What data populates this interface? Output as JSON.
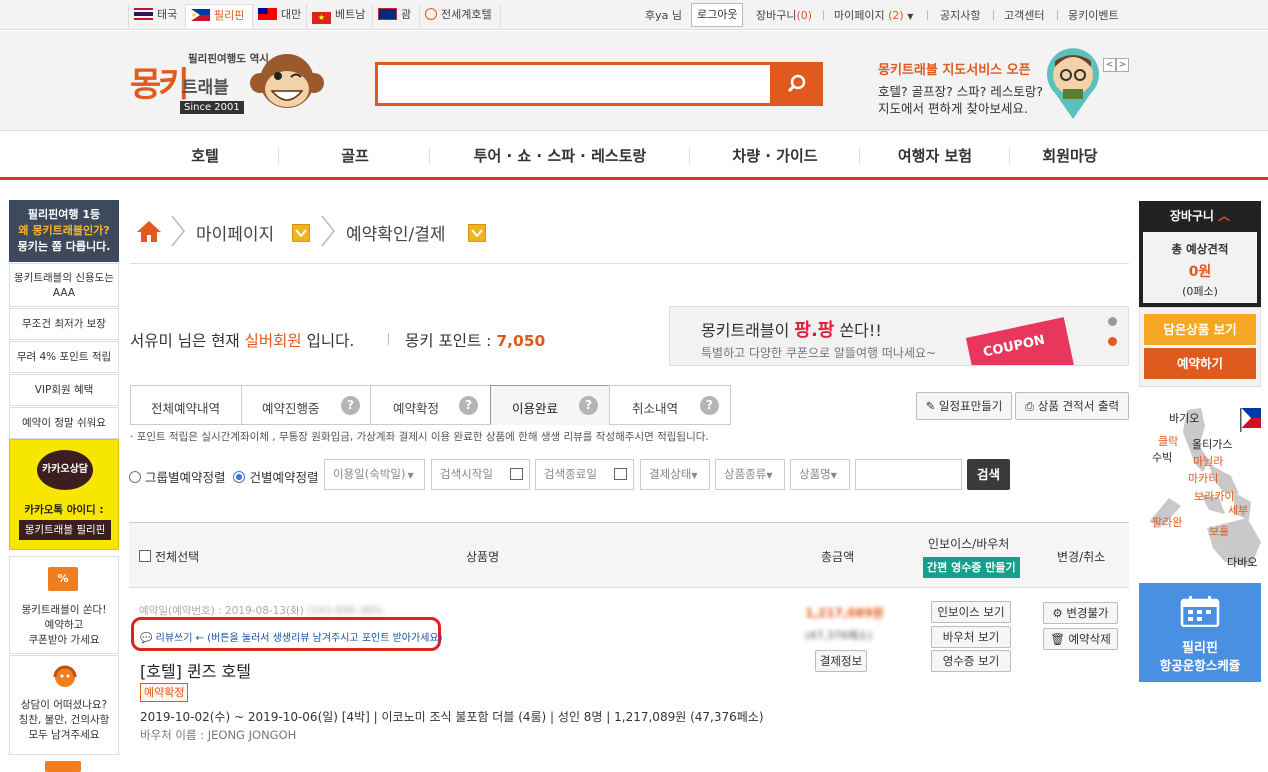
{
  "topbar": {
    "langs": [
      "태국",
      "필리핀",
      "대만",
      "베트남",
      "괌",
      "전세계호텔"
    ],
    "user": "후ya 님",
    "logout": "로그아웃",
    "cart": "장바구니",
    "cart_count": "(0)",
    "mypage": "마이페이지",
    "mypage_count": "(2)",
    "notice": "공지사항",
    "support": "고객센터",
    "event": "몽키이벤트"
  },
  "header": {
    "logo_tagline": "필리핀여행도 역시",
    "logo_main": "몽키",
    "logo_sub": "트래블",
    "logo_since": "Since 2001",
    "map_title": "몽키트래블 지도서비스 오픈",
    "map_line1": "호텔? 골프장? 스파? 레스토랑?",
    "map_line2": "지도에서 편하게 찾아보세요."
  },
  "nav": [
    "호텔",
    "골프",
    "투어 · 쇼 · 스파 · 레스토랑",
    "차량 · 가이드",
    "여행자 보험",
    "회원마당"
  ],
  "left_sidebar": {
    "promo_line1": "필리핀여행 1등",
    "promo_line2": "왜 몽키트래블인가?",
    "promo_line3": "몽키는 쫌 다릅니다.",
    "items": [
      "몽키트래블의 신용도는 AAA",
      "무조건 최저가 보장",
      "무려 4% 포인트 적립",
      "VIP회원 혜택",
      "예약이 정말 쉬워요"
    ],
    "kakao_bubble": "카카오상담",
    "kakao_label": "카카오톡 아이디 :",
    "kakao_id": "몽키트래블 필리핀",
    "coupon_line1": "몽키트래블이 쏜다!",
    "coupon_line2": "예약하고",
    "coupon_line3": "쿠폰받아 가세요",
    "survey_line1": "상담이 어떠셨나요?",
    "survey_line2": "칭찬, 불만, 건의사항",
    "survey_line3": "모두 남겨주세요"
  },
  "breadcrumb": {
    "level1": "마이페이지",
    "level2": "예약확인/결제"
  },
  "member": {
    "name_prefix": "서유미 님은 현재 ",
    "grade": "실버회원",
    "name_suffix": " 입니다.",
    "points_label": "몽키 포인트 : ",
    "points": "7,050"
  },
  "banner": {
    "title_prefix": "몽키트래블이 ",
    "title_hl": "팡.팡",
    "title_suffix": " 쏜다!!",
    "sub": "특별하고 다양한 쿠폰으로 알뜰여행 떠나세요~",
    "coupon": "COUPON"
  },
  "tabs": [
    "전체예약내역",
    "예약진행중",
    "예약확정",
    "이용완료",
    "취소내역"
  ],
  "tab_help": "?",
  "actions": {
    "schedule": "일정표만들기",
    "estimate": "상품 견적서 출력"
  },
  "notice": "포인트 적립은 실시간계좌이체 , 무통장 원화입금, 가상계좌 결제시 이용 완료한 상품에 한해 생생 리뷰를 작성해주시면 적립됩니다.",
  "filters": {
    "group_label": "그룹별예약정렬",
    "each_label": "건별예약정렬",
    "use_date": "이용일(숙박일)",
    "search_start": "검색시작일",
    "search_end": "검색종료일",
    "pay_status": "결제상태",
    "product_type": "상품종류",
    "product_name": "상품명",
    "keyword": "",
    "search_button": "검색"
  },
  "table": {
    "select_all": "전체선택",
    "col_product": "상품명",
    "col_total": "총금액",
    "col_invoice": "인보이스/바우처",
    "receipt_button": "간편 영수증 만들기",
    "col_change": "변경/취소"
  },
  "booking": {
    "meta": "예약일(예약번호) : 2019-08-13(화)",
    "booking_no": "(143-899-385)",
    "review_label": "리뷰쓰기",
    "review_hint": "← (버튼을 눌러서 생생리뷰 남겨주시고 포인트 받아가세요)",
    "title": "[호텔] 퀸즈 호텔",
    "status": "예약확정",
    "details": "2019-10-02(수) ~ 2019-10-06(일) [4박]  |  이코노미 조식 불포함 더블 (4룸)  |  성인 8명  |  1,217,089원 (47,376페소)",
    "voucher_name": "바우처 이름 : JEONG JONGOH",
    "price_krw": "1,217,089원",
    "price_php": "(47,376페소)",
    "payinfo": "결제정보",
    "invoice_view": "인보이스 보기",
    "voucher_view": "바우처 보기",
    "receipt_view": "영수증 보기",
    "no_change": "변경불가",
    "delete": "예약삭제"
  },
  "right_sidebar": {
    "cart_title": "장바구니",
    "estimate_label": "총 예상견적",
    "estimate_value": "0원",
    "estimate_php": "(0페소)",
    "saved_button": "담은상품 보기",
    "book_button": "예약하기",
    "map_places": [
      "바기오",
      "클락",
      "올티가스",
      "수빅",
      "마닐라",
      "마카티",
      "보라카이",
      "세부",
      "팔라완",
      "보홀",
      "다바오"
    ],
    "flight_line1": "필리핀",
    "flight_line2": "항공운항스케쥴"
  }
}
